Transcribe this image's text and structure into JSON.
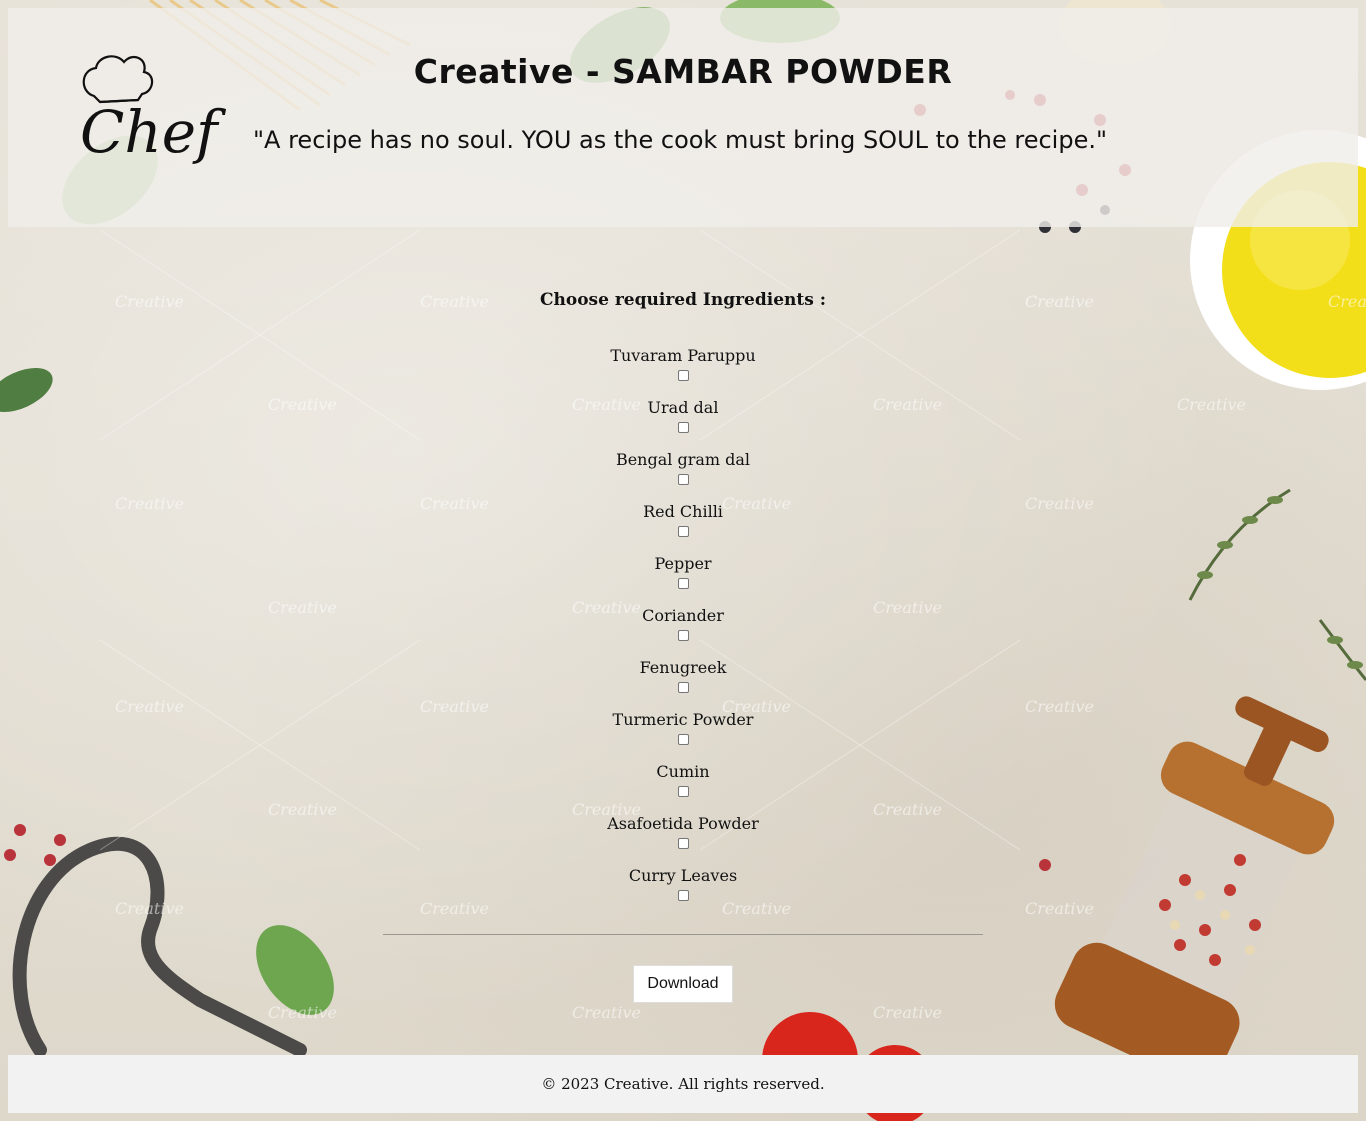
{
  "header": {
    "title": "Creative - SAMBAR POWDER",
    "quote": "\"A recipe has no soul. YOU as the cook must bring SOUL to the recipe.\"",
    "logo_text": "Chef"
  },
  "main": {
    "heading": "Choose required Ingredients :",
    "ingredients": [
      {
        "label": "Tuvaram Paruppu",
        "checked": false
      },
      {
        "label": "Urad dal",
        "checked": false
      },
      {
        "label": "Bengal gram dal",
        "checked": false
      },
      {
        "label": "Red Chilli",
        "checked": false
      },
      {
        "label": "Pepper",
        "checked": false
      },
      {
        "label": "Coriander",
        "checked": false
      },
      {
        "label": "Fenugreek",
        "checked": false
      },
      {
        "label": "Turmeric Powder",
        "checked": false
      },
      {
        "label": "Cumin",
        "checked": false
      },
      {
        "label": "Asafoetida Powder",
        "checked": false
      },
      {
        "label": "Curry Leaves",
        "checked": false
      }
    ],
    "download_label": "Download"
  },
  "footer": {
    "text": "© 2023 Creative. All rights reserved."
  },
  "watermark": "Creative",
  "colors": {
    "background": "#e4dfd4",
    "header_bg": "#f0eeea",
    "footer_bg": "#f2f2f2"
  }
}
